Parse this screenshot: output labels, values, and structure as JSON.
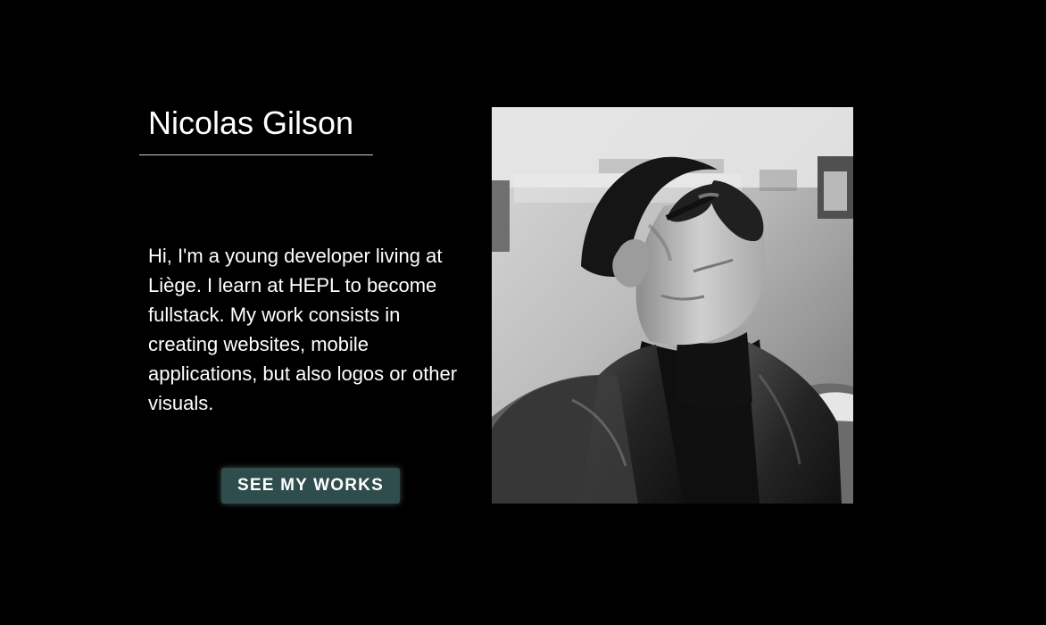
{
  "profile": {
    "name": "Nicolas Gilson",
    "bio": "Hi, I'm a young developer living at Liège. I learn at HEPL to become fullstack. My work consists in creating websites, mobile applications, but also logos or other visuals."
  },
  "cta": {
    "label": "See my works"
  },
  "portrait": {
    "alt": "",
    "tone": "black-and-white"
  },
  "colors": {
    "background": "#000000",
    "text": "#ffffff",
    "button": "#2e4d4c"
  }
}
